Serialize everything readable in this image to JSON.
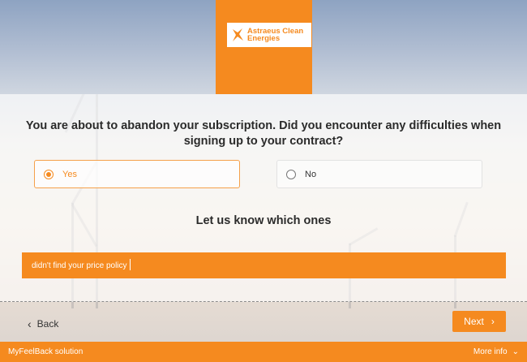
{
  "brand": {
    "name": "Astraeus Clean Energies",
    "accent_color": "#f58a1f",
    "logo_icon": "lightning-star-icon"
  },
  "survey": {
    "question": "You are about to abandon your subscription. Did you encounter any difficulties when signing up to your contract?",
    "options": [
      {
        "label": "Yes",
        "selected": true
      },
      {
        "label": "No",
        "selected": false
      }
    ],
    "follow_up_heading": "Let us know which ones",
    "answer_value": "didn't find your price policy"
  },
  "navigation": {
    "back_label": "Back",
    "next_label": "Next"
  },
  "footer": {
    "left_text": "MyFeelBack solution",
    "right_text": "More info"
  }
}
